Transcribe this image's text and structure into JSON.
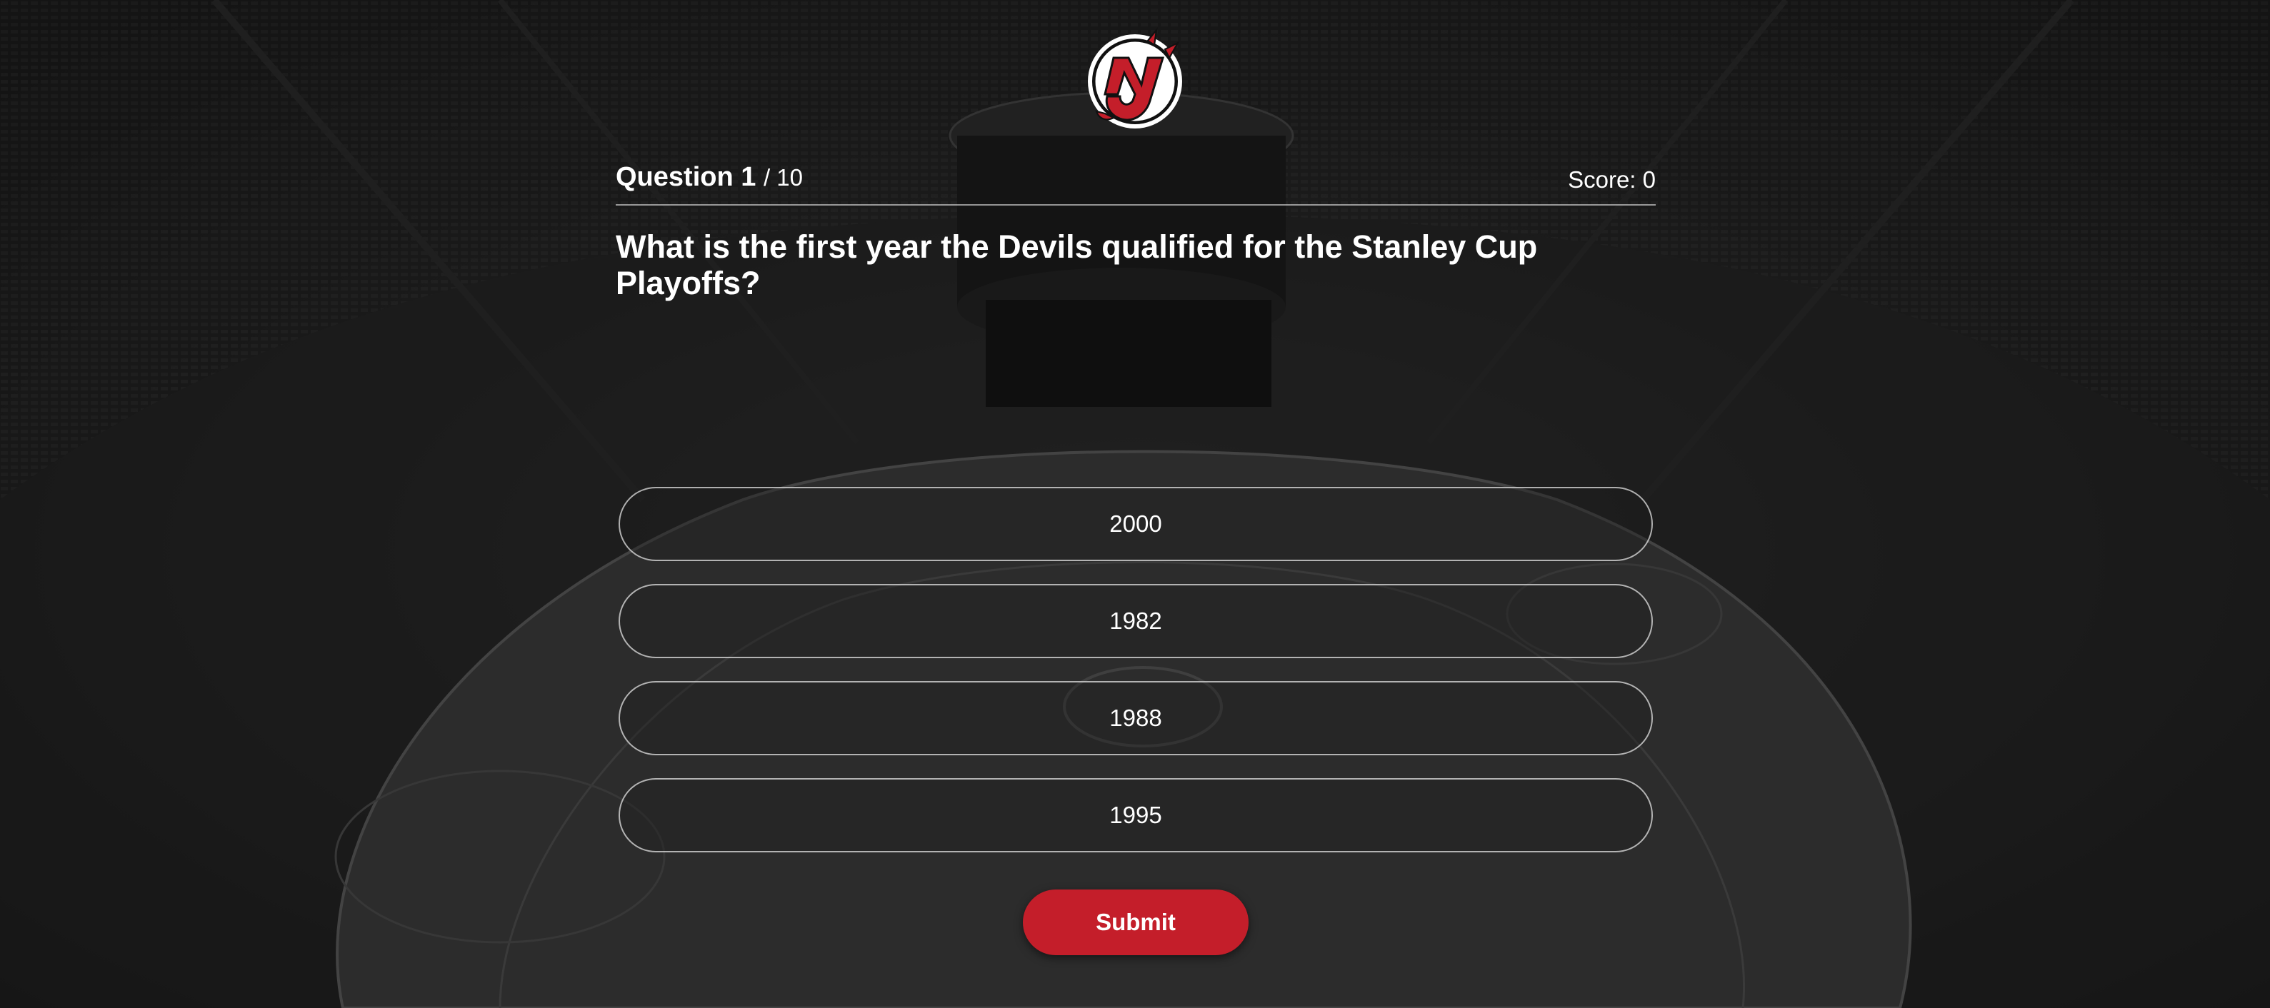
{
  "brand": {
    "logo_icon": "new-jersey-devils-logo",
    "accent_color": "#c41e2a",
    "background_image": "arena-seating-and-rink"
  },
  "header": {
    "question_label": "Question 1",
    "question_total": "/ 10",
    "score_text": "Score: 0"
  },
  "question": {
    "text": "What is the first year the Devils qualified for the Stanley Cup Playoffs?"
  },
  "answers": [
    {
      "label": "2000"
    },
    {
      "label": "1982"
    },
    {
      "label": "1988"
    },
    {
      "label": "1995"
    }
  ],
  "actions": {
    "submit_label": "Submit"
  }
}
